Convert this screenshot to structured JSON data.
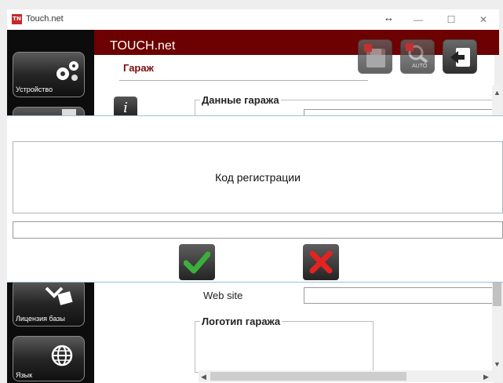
{
  "window": {
    "app_icon_text": "TN",
    "title": "Touch.net",
    "resize_glyph": "↔",
    "minimize_glyph": "—",
    "maximize_glyph": "☐",
    "close_glyph": "✕"
  },
  "header": {
    "app_name": "TOUCH.net",
    "page_title": "Гараж",
    "background_color": "#6d0000",
    "toolbar_icons": [
      "save-disabled-icon",
      "search-auto-icon",
      "exit-icon"
    ],
    "search_badge": "AUTO"
  },
  "sidebar": {
    "items": [
      {
        "label": "Устройство",
        "icon": "gears-icon"
      },
      {
        "label": "",
        "icon": "document-icon"
      },
      {
        "label": "Лицензия базы",
        "icon": "license-icon"
      },
      {
        "label": "Язык",
        "icon": "globe-icon"
      }
    ]
  },
  "content": {
    "garage_data_legend": "Данные гаража",
    "website_label": "Web site",
    "website_value": "",
    "logo_legend": "Логотип гаража",
    "info_icon": "i"
  },
  "dialog": {
    "message": "Код регистрации",
    "input_value": "",
    "ok_icon": "checkmark-icon",
    "cancel_icon": "cross-icon",
    "ok_color": "#3cae3c",
    "cancel_color": "#e52222"
  }
}
